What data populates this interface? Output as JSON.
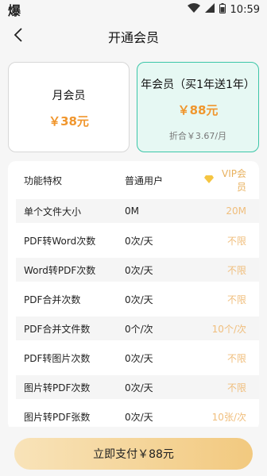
{
  "status_bar": {
    "app_icon_glyph": "爆",
    "time": "10:59",
    "icons": [
      "wifi-icon",
      "signal-icon",
      "battery-icon"
    ]
  },
  "nav": {
    "title": "开通会员",
    "back_icon": "chevron-left-icon"
  },
  "plans": [
    {
      "name": "月会员",
      "price": "￥38元",
      "sub": "",
      "selected": false
    },
    {
      "name": "年会员（买1年送1年）",
      "price": "￥88元",
      "sub": "折合￥3.67/月",
      "selected": true
    }
  ],
  "table": {
    "headers": {
      "feature": "功能特权",
      "normal": "普通用户",
      "vip": "VIP会员",
      "vip_icon": "diamond-icon"
    },
    "rows": [
      {
        "feature": "单个文件大小",
        "normal": "0M",
        "vip": "20M"
      },
      {
        "feature": "PDF转Word次数",
        "normal": "0次/天",
        "vip": "不限"
      },
      {
        "feature": "Word转PDF次数",
        "normal": "0次/天",
        "vip": "不限"
      },
      {
        "feature": "PDF合并次数",
        "normal": "0次/天",
        "vip": "不限"
      },
      {
        "feature": "PDF合并文件数",
        "normal": "0个/次",
        "vip": "10个/次"
      },
      {
        "feature": "PDF转图片次数",
        "normal": "0次/天",
        "vip": "不限"
      },
      {
        "feature": "图片转PDF次数",
        "normal": "0次/天",
        "vip": "不限"
      },
      {
        "feature": "图片转PDF张数",
        "normal": "0次/天",
        "vip": "10张/次"
      }
    ]
  },
  "pay_button": {
    "label": "立即支付￥88元"
  },
  "colors": {
    "accent_orange": "#f0962d",
    "vip_gold": "#f0be7c",
    "selected_border": "#3cc6a8",
    "selected_bg": "#e6f8f3"
  }
}
